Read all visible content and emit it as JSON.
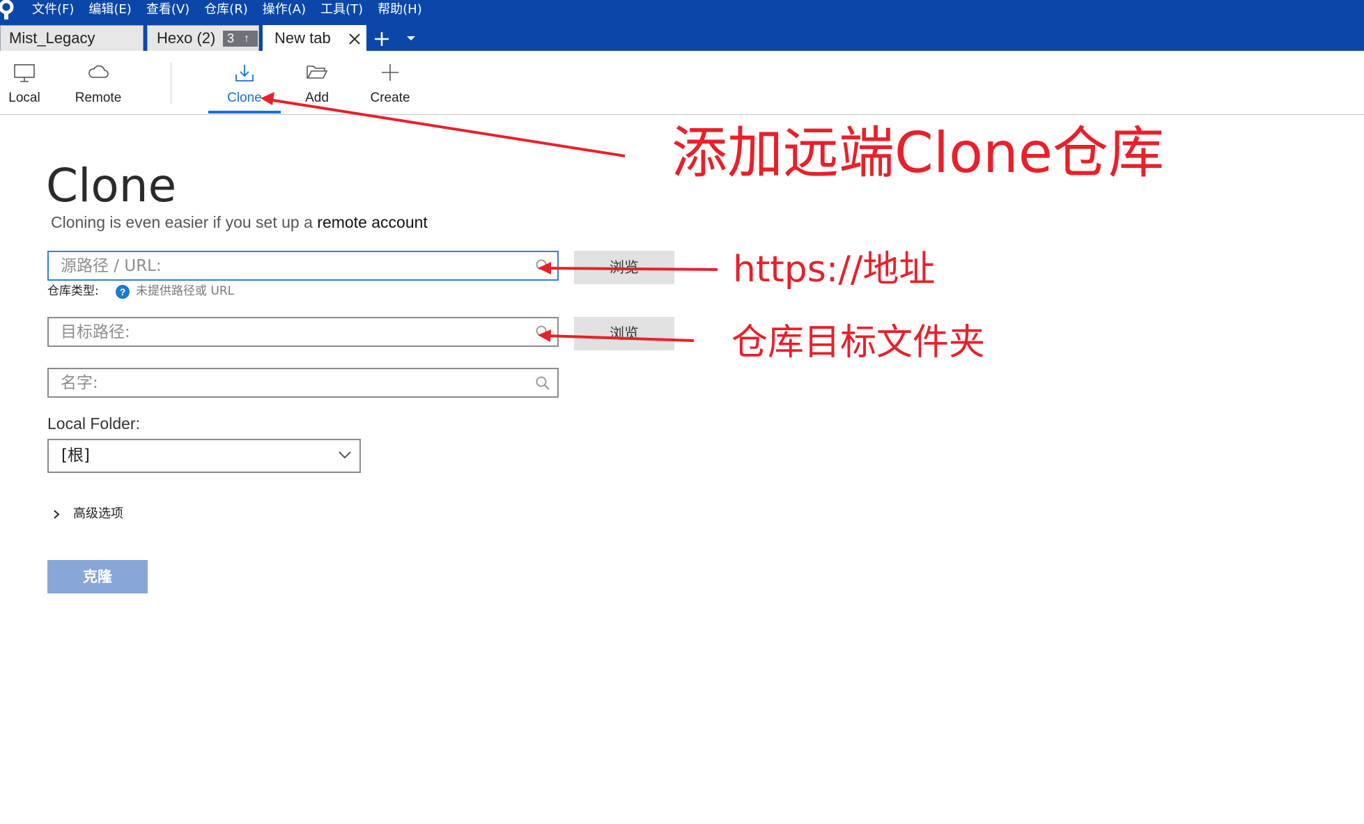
{
  "menu": [
    "文件(F)",
    "编辑(E)",
    "查看(V)",
    "仓库(R)",
    "操作(A)",
    "工具(T)",
    "帮助(H)"
  ],
  "tabs": [
    {
      "label": "Mist_Legacy"
    },
    {
      "label": "Hexo (2)",
      "badge_count": "3",
      "badge_arrow": "↑"
    },
    {
      "label": "New tab",
      "active": true
    }
  ],
  "toolbar": {
    "local": "Local",
    "remote": "Remote",
    "clone": "Clone",
    "add": "Add",
    "create": "Create"
  },
  "form": {
    "title": "Clone",
    "subtitle_prefix": "Cloning is even easier if you set up a ",
    "subtitle_link": "remote account",
    "source_placeholder": "源路径 / URL:",
    "browse_label": "浏览",
    "repo_type_label": "仓库类型:",
    "repo_type_value": "未提供路径或 URL",
    "dest_placeholder": "目标路径:",
    "name_placeholder": "名字:",
    "local_folder_label": "Local Folder:",
    "local_folder_value": "[根]",
    "advanced_label": "高级选项",
    "submit_label": "克隆"
  },
  "annotations": {
    "clone": "添加远端Clone仓库",
    "url": "https://地址",
    "dest": "仓库目标文件夹",
    "color": "#e8202a"
  },
  "colors": {
    "titlebar": "#0a47a9",
    "accent": "#1a6fd1",
    "submit_disabled": "#89a6d8"
  }
}
